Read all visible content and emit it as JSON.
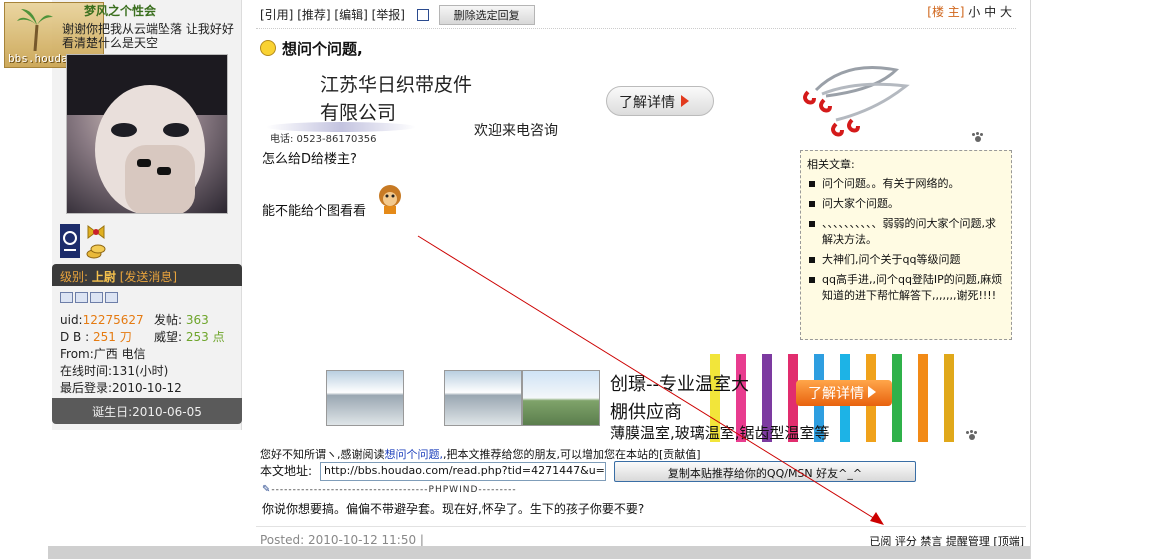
{
  "user": {
    "logo_site": "bbs.houdao.com",
    "name": "梦风之个性会",
    "signature": "谢谢你把我从云端坠落 让我好好看清楚什么是天空",
    "level_label": "级别:",
    "level": "上尉",
    "send_message": "[发送消息]",
    "uid_label": "uid:",
    "uid": "12275627",
    "posts_label": "发帖:",
    "posts": "363",
    "db_label": "D B :",
    "db": "251 刀",
    "prestige_label": "威望:",
    "prestige": "253 点",
    "from": "From:广西 电信",
    "online": "在线时间:131(小时)",
    "last_login": "最后登录:2010-10-12",
    "birthday": "诞生日:2010-06-05"
  },
  "toolbar": {
    "quote": "[引用]",
    "recommend": "[推荐]",
    "edit": "[编辑]",
    "report": "[举报]",
    "delete_selected": "删除选定回复"
  },
  "floor": {
    "owner": "[楼 主]",
    "small": "小",
    "medium": "中",
    "large": "大"
  },
  "post": {
    "title": "想问个问题,",
    "line1": "怎么给D给楼主?",
    "line2": "能不能给个图看看"
  },
  "ad1": {
    "company_line1": "江苏华日织带皮件",
    "company_line2": "有限公司",
    "phone": "电话: 0523-86170356",
    "welcome": "欢迎来电咨询",
    "button": "了解详情"
  },
  "related": {
    "title": "相关文章:",
    "items": [
      "问个问题。。有关于网络的。",
      "问大家个问题。",
      "、、、、、、、、、、弱弱的问大家个问题,求解决方法。",
      "大神们,问个关于qq等级问题",
      "qq高手进,,问个qq登陆IP的问题,麻烦知道的进下帮忙解答下,,,,,,,谢死!!!!"
    ]
  },
  "ad2": {
    "title_line1": "创璟--专业温室大",
    "title_line2": "棚供应商",
    "subtitle": "薄膜温室,玻璃温室,锯齿型温室等",
    "button": "了解详情"
  },
  "share": {
    "prefix": "您好不知所谓ヽ,感谢阅读",
    "link": "想问个问题,",
    "suffix": ",把本文推荐给您的朋友,可以增加您在本站的[贡献值]"
  },
  "url_row": {
    "label": "本文地址:",
    "value": "http://bbs.houdao.com/read.php?tid=4271447&u=4",
    "copy_button": "复制本贴推荐给你的QQ/MSN 好友^_^"
  },
  "signature_line": "-------------------------------------PHPWIND---------",
  "signature_text": "你说你想要搞。偏偏不带避孕套。现在好,怀孕了。生下的孩子你要不要?",
  "footer": {
    "posted": "Posted: 2010-10-12 11:50 |",
    "actions": "已阅 评分 禁言 提醒管理 [顶端]"
  },
  "colors": {
    "level_bar_bg": "#3b3b3b",
    "owner_link": "#d0661c",
    "related_bg": "#fffbe3",
    "arrow": "#cc0000"
  }
}
